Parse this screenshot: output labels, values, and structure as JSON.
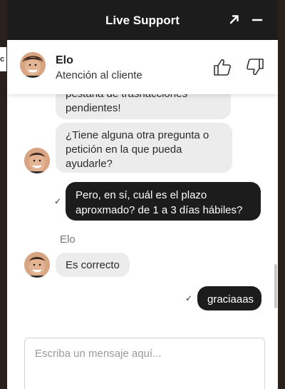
{
  "header": {
    "title": "Live Support",
    "expand_icon": "expand-arrow-icon",
    "minimize_icon": "minimize-icon"
  },
  "agent": {
    "name": "Elo",
    "role": "Atención al cliente",
    "like_icon": "thumbs-up-icon",
    "dislike_icon": "thumbs-down-icon"
  },
  "messages": [
    {
      "from": "agent",
      "text_line1": "pestaña de trasnacciones",
      "text_line2": "pendientes!"
    },
    {
      "from": "agent",
      "text_line1": "¿Tiene alguna otra pregunta o",
      "text_line2": "petición en la que pueda",
      "text_line3": "ayudarle?"
    },
    {
      "from": "user",
      "status": "✓",
      "text_line1": "Pero, en sí, cuál es el plazo",
      "text_line2": "aproxmado? de 1 a 3 días hábiles?"
    },
    {
      "from": "agent",
      "sender": "Elo",
      "text": "Es correcto"
    },
    {
      "from": "user",
      "status": "✓",
      "text": "graciaaas"
    }
  ],
  "composer": {
    "placeholder": "Escriba un mensaje aquí..."
  },
  "background_edge_text": "c",
  "colors": {
    "header_bg": "#1c1c1c",
    "outgoing_bubble": "#1c1c1c",
    "incoming_bubble": "#ececec"
  }
}
